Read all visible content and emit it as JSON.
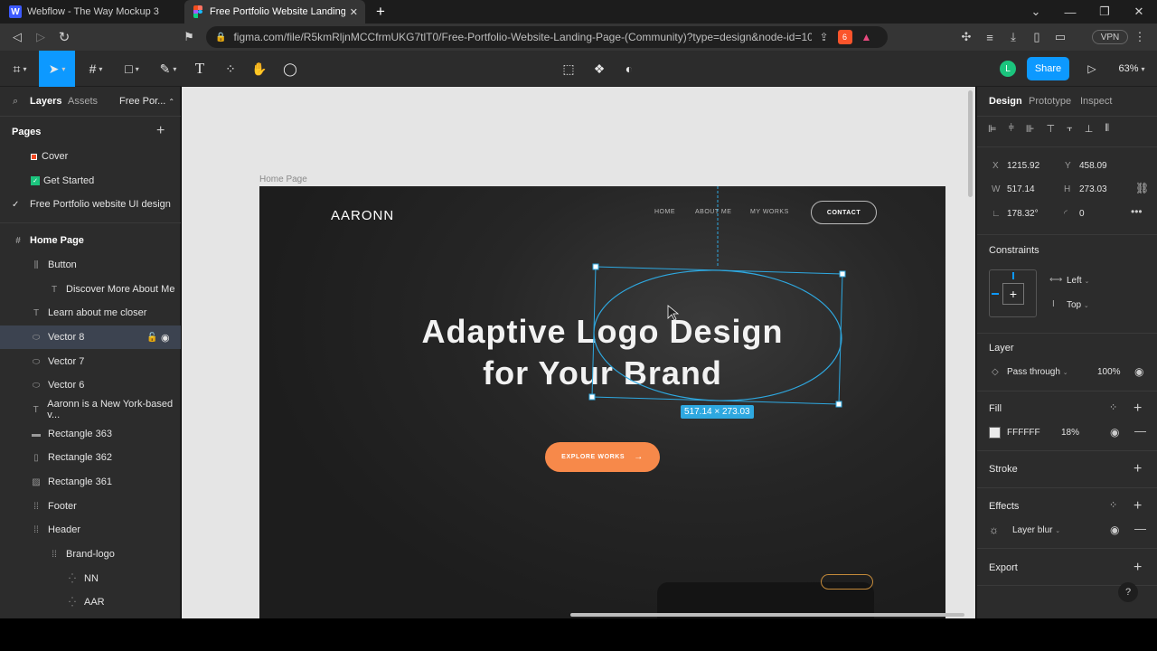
{
  "browser": {
    "tabs": [
      {
        "title": "Webflow - The Way Mockup 3"
      },
      {
        "title": "Free Portfolio Website Landing Pa"
      }
    ],
    "url": "figma.com/file/R5kmRljnMCCfrmUKG7tlT0/Free-Portfolio-Website-Landing-Page-(Community)?type=design&node-id=10...",
    "vpn_label": "VPN",
    "brave_badge": "6"
  },
  "toolbar": {
    "share_label": "Share",
    "zoom": "63%",
    "avatar_initial": "L"
  },
  "left_panel": {
    "tabs": [
      "Layers",
      "Assets",
      "Free Por..."
    ],
    "pages_title": "Pages",
    "pages": [
      {
        "label": "Cover",
        "marker": "red"
      },
      {
        "label": "Get Started",
        "marker": "green"
      },
      {
        "label": "Free Portfolio website UI design",
        "marker": "check"
      }
    ],
    "layers": [
      {
        "label": "Home Page",
        "icon": "frame-icon"
      },
      {
        "label": "Button",
        "icon": "autolayout-icon"
      },
      {
        "label": "Discover More About Me",
        "icon": "text-icon"
      },
      {
        "label": "Learn about me closer",
        "icon": "text-icon"
      },
      {
        "label": "Vector 8",
        "icon": "ellipse-icon"
      },
      {
        "label": "Vector 7",
        "icon": "ellipse-icon"
      },
      {
        "label": "Vector 6",
        "icon": "ellipse-icon"
      },
      {
        "label": "Aaronn is a New York-based v...",
        "icon": "text-icon"
      },
      {
        "label": "Rectangle 363",
        "icon": "rect-icon"
      },
      {
        "label": "Rectangle 362",
        "icon": "rect-icon"
      },
      {
        "label": "Rectangle 361",
        "icon": "image-icon"
      },
      {
        "label": "Footer",
        "icon": "group-icon"
      },
      {
        "label": "Header",
        "icon": "group-icon"
      },
      {
        "label": "Brand-logo",
        "icon": "group-icon"
      },
      {
        "label": "NN",
        "icon": "component-icon"
      },
      {
        "label": "AAR",
        "icon": "component-icon"
      }
    ]
  },
  "canvas": {
    "frame_label": "Home Page",
    "logo": "AARONN",
    "nav": [
      "HOME",
      "ABOUT ME",
      "MY WORKS"
    ],
    "contact_label": "CONTACT",
    "headline_line1": "Adaptive Logo Design",
    "headline_line2": "for Your Brand",
    "cta_label": "EXPLORE WORKS",
    "size_badge": "517.14 × 273.03",
    "accent": "#f7894a",
    "selection_color": "#2ea8e0"
  },
  "right_panel": {
    "tabs": [
      "Design",
      "Prototype",
      "Inspect"
    ],
    "x": "1215.92",
    "y": "458.09",
    "w": "517.14",
    "h": "273.03",
    "rotation": "178.32°",
    "radius": "0",
    "constraints_title": "Constraints",
    "constraint_h": "Left",
    "constraint_v": "Top",
    "layer_title": "Layer",
    "blend": "Pass through",
    "opacity": "100%",
    "fill_title": "Fill",
    "fill_hex": "FFFFFF",
    "fill_opacity": "18%",
    "stroke_title": "Stroke",
    "effects_title": "Effects",
    "effect_name": "Layer blur",
    "export_title": "Export",
    "labels": {
      "x": "X",
      "y": "Y",
      "w": "W",
      "h": "H"
    }
  }
}
